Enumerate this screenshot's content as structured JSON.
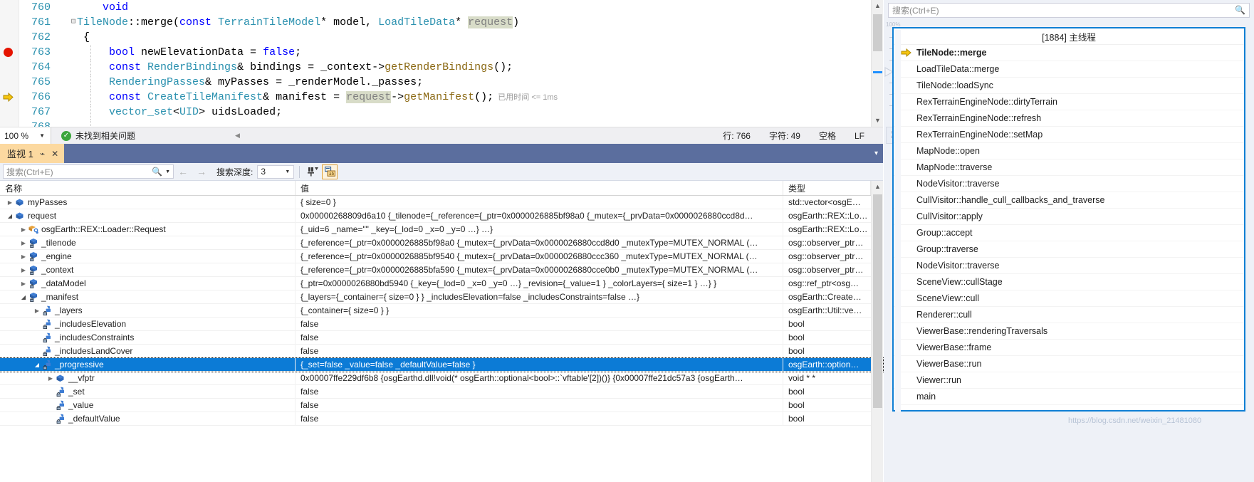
{
  "editor": {
    "lines": [
      {
        "num": "760",
        "marker": "none",
        "fold": "",
        "indent": false,
        "tokens": [
          {
            "t": "    ",
            "c": "pl"
          },
          {
            "t": "void",
            "c": "kw"
          }
        ]
      },
      {
        "num": "761",
        "marker": "none",
        "fold": "minus",
        "indent": false,
        "tokens": [
          {
            "t": "TileNode",
            "c": "typ"
          },
          {
            "t": "::merge(",
            "c": "pl"
          },
          {
            "t": "const ",
            "c": "kw"
          },
          {
            "t": "TerrainTileModel",
            "c": "typ"
          },
          {
            "t": "* model, ",
            "c": "pl"
          },
          {
            "t": "LoadTileData",
            "c": "typ"
          },
          {
            "t": "* ",
            "c": "pl"
          },
          {
            "t": "request",
            "c": "gray hl"
          },
          {
            "t": ")",
            "c": "pl"
          }
        ]
      },
      {
        "num": "762",
        "marker": "none",
        "fold": "",
        "indent": false,
        "tokens": [
          {
            "t": " {",
            "c": "pl"
          }
        ]
      },
      {
        "num": "763",
        "marker": "breakpoint",
        "fold": "",
        "indent": true,
        "tokens": [
          {
            "t": "     ",
            "c": "pl"
          },
          {
            "t": "bool",
            "c": "kw"
          },
          {
            "t": " newElevationData = ",
            "c": "pl"
          },
          {
            "t": "false",
            "c": "kw"
          },
          {
            "t": ";",
            "c": "pl"
          }
        ]
      },
      {
        "num": "764",
        "marker": "none",
        "fold": "",
        "indent": true,
        "tokens": [
          {
            "t": "     ",
            "c": "pl"
          },
          {
            "t": "const ",
            "c": "kw"
          },
          {
            "t": "RenderBindings",
            "c": "typ"
          },
          {
            "t": "& bindings = _context->",
            "c": "pl"
          },
          {
            "t": "getRenderBindings",
            "c": "fn"
          },
          {
            "t": "();",
            "c": "pl"
          }
        ]
      },
      {
        "num": "765",
        "marker": "none",
        "fold": "",
        "indent": true,
        "tokens": [
          {
            "t": "     ",
            "c": "pl"
          },
          {
            "t": "RenderingPasses",
            "c": "typ"
          },
          {
            "t": "& myPasses = _renderModel._passes;",
            "c": "pl"
          }
        ]
      },
      {
        "num": "766",
        "marker": "current",
        "fold": "",
        "indent": true,
        "tokens": [
          {
            "t": "     ",
            "c": "pl"
          },
          {
            "t": "const ",
            "c": "kw"
          },
          {
            "t": "CreateTileManifest",
            "c": "typ"
          },
          {
            "t": "& manifest = ",
            "c": "pl"
          },
          {
            "t": "request",
            "c": "gray hl"
          },
          {
            "t": "->",
            "c": "pl"
          },
          {
            "t": "getManifest",
            "c": "fn"
          },
          {
            "t": "();",
            "c": "pl"
          }
        ],
        "elapsed": "已用时间 <= 1ms"
      },
      {
        "num": "767",
        "marker": "none",
        "fold": "",
        "indent": true,
        "tokens": [
          {
            "t": "     ",
            "c": "pl"
          },
          {
            "t": "vector_set",
            "c": "typ"
          },
          {
            "t": "<",
            "c": "pl"
          },
          {
            "t": "UID",
            "c": "typ"
          },
          {
            "t": "> uidsLoaded;",
            "c": "pl"
          }
        ]
      },
      {
        "num": "768",
        "marker": "none",
        "fold": "",
        "indent": true,
        "tokens": [
          {
            "t": "",
            "c": "pl"
          }
        ]
      }
    ]
  },
  "editor_status": {
    "zoom": "100 %",
    "issues_text": "未找到相关问题",
    "line": "行: 766",
    "column": "字符: 49",
    "spaces": "空格",
    "eol": "LF"
  },
  "watch": {
    "tab_label": "监视 1",
    "search_placeholder": "搜索(Ctrl+E)",
    "depth_label": "搜索深度:",
    "depth_value": "3",
    "columns": [
      "名称",
      "值",
      "类型"
    ],
    "rows": [
      {
        "indent": 0,
        "expander": "collapsed",
        "icon": "field-blue",
        "name": "myPasses",
        "value": "{ size=0 }",
        "type": "std::vector<osgE…",
        "selected": false
      },
      {
        "indent": 0,
        "expander": "expanded",
        "icon": "field-blue",
        "name": "request",
        "value": "0x00000268809d6a10 {_tilenode={_reference={_ptr=0x0000026885bf98a0 {_mutex={_prvData=0x0000026880ccd8d…",
        "type": "osgEarth::REX::Lo…",
        "selected": false
      },
      {
        "indent": 1,
        "expander": "collapsed",
        "icon": "base-orange",
        "name": "osgEarth::REX::Loader::Request",
        "value": "{_uid=6 _name=\"\" _key={_lod=0 _x=0 _y=0 …} …}",
        "type": "osgEarth::REX::Lo…",
        "selected": false
      },
      {
        "indent": 1,
        "expander": "collapsed",
        "icon": "field-private",
        "name": "_tilenode",
        "value": "{_reference={_ptr=0x0000026885bf98a0 {_mutex={_prvData=0x0000026880ccd8d0 _mutexType=MUTEX_NORMAL (…",
        "type": "osg::observer_ptr…",
        "selected": false
      },
      {
        "indent": 1,
        "expander": "collapsed",
        "icon": "field-private",
        "name": "_engine",
        "value": "{_reference={_ptr=0x0000026885bf9540 {_mutex={_prvData=0x0000026880ccc360 _mutexType=MUTEX_NORMAL (…",
        "type": "osg::observer_ptr…",
        "selected": false
      },
      {
        "indent": 1,
        "expander": "collapsed",
        "icon": "field-private",
        "name": "_context",
        "value": "{_reference={_ptr=0x0000026885bfa590 {_mutex={_prvData=0x0000026880cce0b0 _mutexType=MUTEX_NORMAL (…",
        "type": "osg::observer_ptr…",
        "selected": false
      },
      {
        "indent": 1,
        "expander": "collapsed",
        "icon": "field-private",
        "name": "_dataModel",
        "value": "{_ptr=0x0000026880bd5940 {_key={_lod=0 _x=0 _y=0 …} _revision={_value=1 } _colorLayers={ size=1 } …} }",
        "type": "osg::ref_ptr<osg…",
        "selected": false
      },
      {
        "indent": 1,
        "expander": "expanded",
        "icon": "field-private",
        "name": "_manifest",
        "value": "{_layers={_container={ size=0 } } _includesElevation=false _includesConstraints=false …}",
        "type": "osgEarth::Create…",
        "selected": false
      },
      {
        "indent": 2,
        "expander": "collapsed",
        "icon": "field-lock",
        "name": "_layers",
        "value": "{_container={ size=0 } }",
        "type": "osgEarth::Util::ve…",
        "selected": false
      },
      {
        "indent": 2,
        "expander": "none",
        "icon": "field-lock",
        "name": "_includesElevation",
        "value": "false",
        "type": "bool",
        "selected": false
      },
      {
        "indent": 2,
        "expander": "none",
        "icon": "field-lock",
        "name": "_includesConstraints",
        "value": "false",
        "type": "bool",
        "selected": false
      },
      {
        "indent": 2,
        "expander": "none",
        "icon": "field-lock",
        "name": "_includesLandCover",
        "value": "false",
        "type": "bool",
        "selected": false
      },
      {
        "indent": 2,
        "expander": "expanded",
        "icon": "field-lock",
        "name": "_progressive",
        "value": "{_set=false _value=false _defaultValue=false }",
        "type": "osgEarth::option…",
        "selected": true
      },
      {
        "indent": 3,
        "expander": "collapsed",
        "icon": "field-blue",
        "name": "__vfptr",
        "value": "0x00007ffe229df6b8 {osgEarthd.dll!void(* osgEarth::optional<bool>::`vftable'[2])()} {0x00007ffe21dc57a3 {osgEarth…",
        "type": "void * *",
        "selected": false
      },
      {
        "indent": 3,
        "expander": "none",
        "icon": "field-lock",
        "name": "_set",
        "value": "false",
        "type": "bool",
        "selected": false
      },
      {
        "indent": 3,
        "expander": "none",
        "icon": "field-lock",
        "name": "_value",
        "value": "false",
        "type": "bool",
        "selected": false
      },
      {
        "indent": 3,
        "expander": "none",
        "icon": "field-lock",
        "name": "_defaultValue",
        "value": "false",
        "type": "bool",
        "selected": false
      }
    ]
  },
  "callstack": {
    "search_placeholder": "搜索(Ctrl+E)",
    "thread_header": "[1884] 主线程",
    "scale_label": "100%",
    "frames": [
      {
        "label": "TileNode::merge",
        "marker": "current"
      },
      {
        "label": "LoadTileData::merge",
        "marker": "none"
      },
      {
        "label": "TileNode::loadSync",
        "marker": "none"
      },
      {
        "label": "RexTerrainEngineNode::dirtyTerrain",
        "marker": "none"
      },
      {
        "label": "RexTerrainEngineNode::refresh",
        "marker": "none"
      },
      {
        "label": "RexTerrainEngineNode::setMap",
        "marker": "none"
      },
      {
        "label": "MapNode::open",
        "marker": "none"
      },
      {
        "label": "MapNode::traverse",
        "marker": "none"
      },
      {
        "label": "NodeVisitor::traverse",
        "marker": "none"
      },
      {
        "label": "CullVisitor::handle_cull_callbacks_and_traverse",
        "marker": "none"
      },
      {
        "label": "CullVisitor::apply",
        "marker": "none"
      },
      {
        "label": "Group::accept",
        "marker": "none"
      },
      {
        "label": "Group::traverse",
        "marker": "none"
      },
      {
        "label": "NodeVisitor::traverse",
        "marker": "none"
      },
      {
        "label": "SceneView::cullStage",
        "marker": "none"
      },
      {
        "label": "SceneView::cull",
        "marker": "none"
      },
      {
        "label": "Renderer::cull",
        "marker": "none"
      },
      {
        "label": "ViewerBase::renderingTraversals",
        "marker": "none"
      },
      {
        "label": "ViewerBase::frame",
        "marker": "none"
      },
      {
        "label": "ViewerBase::run",
        "marker": "none"
      },
      {
        "label": "Viewer::run",
        "marker": "none"
      },
      {
        "label": "main",
        "marker": "none"
      }
    ],
    "watermark": "https://blog.csdn.net/weixin_21481080"
  },
  "colors": {
    "accent_blue": "#0c7bd6",
    "breakpoint_red": "#e51400",
    "current_arrow": "#e8b10a",
    "tab_active": "#fcd9a0",
    "panel_border": "#0f7fd4"
  }
}
